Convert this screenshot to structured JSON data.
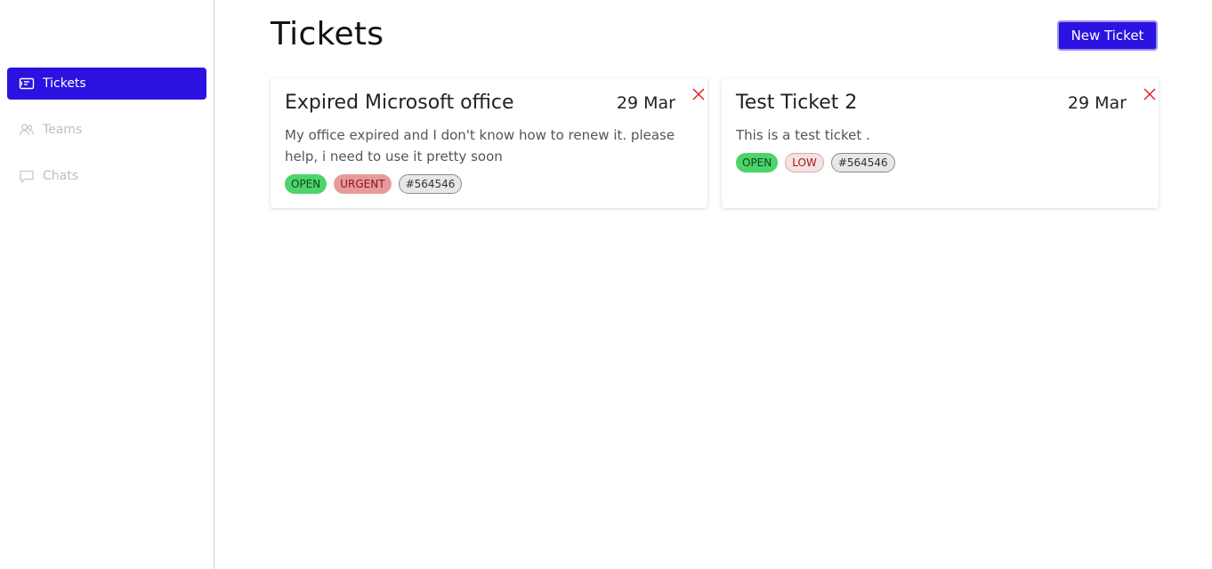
{
  "sidebar": {
    "items": [
      {
        "label": "Tickets",
        "icon": "ticket-icon",
        "active": true
      },
      {
        "label": "Teams",
        "icon": "users-icon",
        "active": false
      },
      {
        "label": "Chats",
        "icon": "chat-bubble-icon",
        "active": false
      }
    ]
  },
  "header": {
    "title": "Tickets",
    "new_ticket_label": "New Ticket"
  },
  "tickets": [
    {
      "title": "Expired Microsoft office",
      "date": "29 Mar",
      "description": "My office expired and I don't know how to renew it. please help, i need to use it pretty soon",
      "status": "OPEN",
      "priority": "URGENT",
      "id": "#564546"
    },
    {
      "title": "Test Ticket 2",
      "date": "29 Mar",
      "description": "This is a test ticket .",
      "status": "OPEN",
      "priority": "LOW",
      "id": "#564546"
    }
  ],
  "colors": {
    "accent": "#2b12e0",
    "open": "#4cd36a",
    "urgent": "#e79a9a",
    "close_icon": "#e02020"
  }
}
